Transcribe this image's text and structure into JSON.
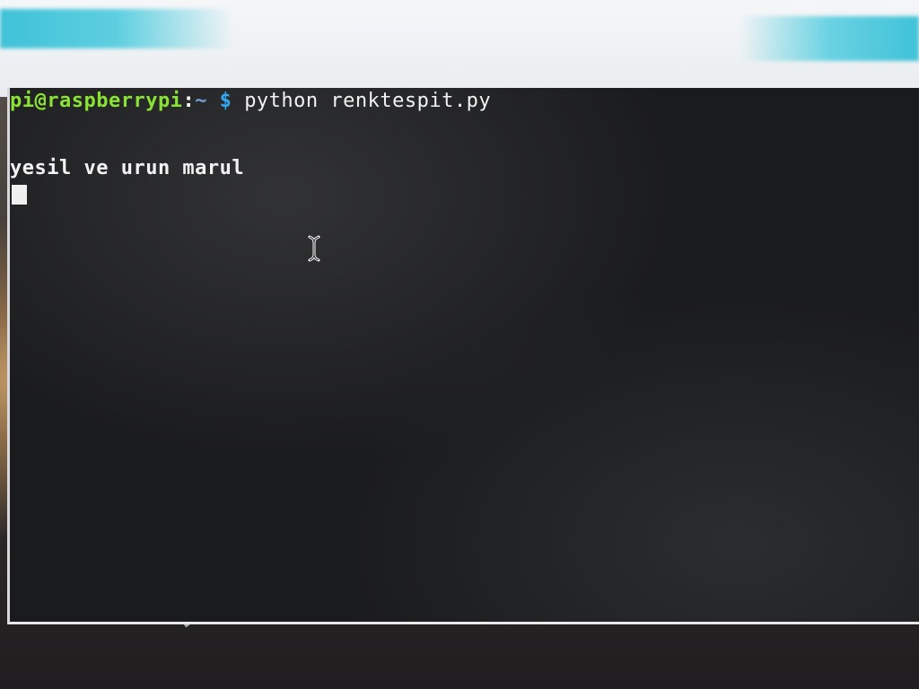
{
  "terminal": {
    "prompt": {
      "user_host": "pi@raspberrypi",
      "separator": ":",
      "path": "~",
      "dollar": " $ "
    },
    "command": "python renktespit.py",
    "output_lines": [
      "yesil ve urun marul"
    ]
  },
  "colors": {
    "prompt_user": "#8ae234",
    "prompt_path": "#729fcf",
    "prompt_dollar": "#34a8f0",
    "terminal_bg": "#1a1b1d",
    "text": "#f2f2f2"
  },
  "icons": {
    "mouse_cursor": "ibeam-cursor-icon",
    "text_cursor": "block-cursor-icon"
  }
}
